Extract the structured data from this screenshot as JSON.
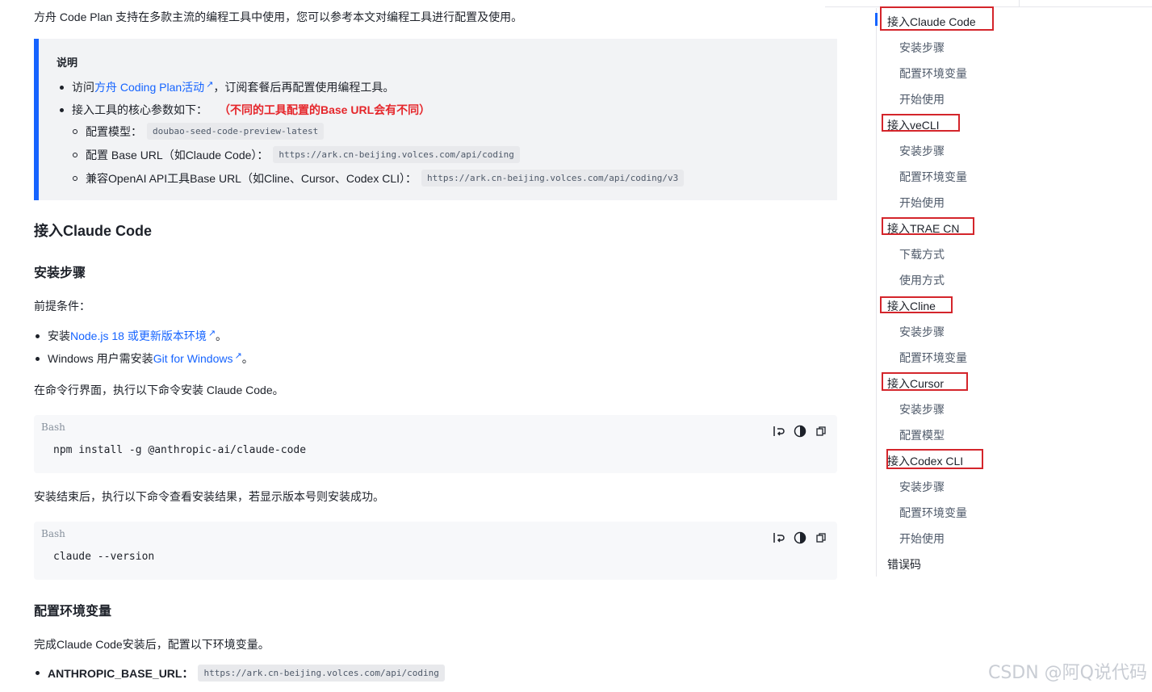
{
  "intro": "方舟 Code Plan 支持在多款主流的编程工具中使用，您可以参考本文对编程工具进行配置及使用。",
  "note": {
    "title": "说明",
    "item1_prefix": "访问",
    "item1_link": "方舟 Coding Plan活动",
    "item1_suffix": "，订阅套餐后再配置使用编程工具。",
    "item2": "接入工具的核心参数如下：",
    "item2_red": "（不同的工具配置的Base URL会有不同）",
    "sub1_label": "配置模型：",
    "sub1_code": "doubao-seed-code-preview-latest",
    "sub2_label": "配置 Base URL（如Claude Code）：",
    "sub2_code": "https://ark.cn-beijing.volces.com/api/coding",
    "sub3_label": "兼容OpenAI API工具Base URL（如Cline、Cursor、Codex CLI）：",
    "sub3_code": "https://ark.cn-beijing.volces.com/api/coding/v3"
  },
  "section": {
    "h2": "接入Claude Code",
    "install_h3": "安装步骤",
    "prereq": "前提条件：",
    "pre1_prefix": "安装 ",
    "pre1_link": "Node.js 18 或更新版本环境",
    "pre1_suffix": "。",
    "pre2_prefix": "Windows 用户需安装 ",
    "pre2_link": "Git for Windows",
    "pre2_suffix": "。",
    "cmd_intro": "在命令行界面，执行以下命令安装 Claude Code。",
    "code1_lang": "Bash",
    "code1": "npm install -g @anthropic-ai/claude-code",
    "after_install": "安装结束后，执行以下命令查看安装结果，若显示版本号则安装成功。",
    "code2_lang": "Bash",
    "code2": "claude --version",
    "env_h3": "配置环境变量",
    "env_intro": "完成Claude Code安装后，配置以下环境变量。",
    "env1_label": "ANTHROPIC_BASE_URL：",
    "env1_code": "https://ark.cn-beijing.volces.com/api/coding"
  },
  "toc": [
    {
      "label": "接入Claude Code",
      "level": 1
    },
    {
      "label": "安装步骤",
      "level": 2
    },
    {
      "label": "配置环境变量",
      "level": 2
    },
    {
      "label": "开始使用",
      "level": 2
    },
    {
      "label": "接入veCLI",
      "level": 1
    },
    {
      "label": "安装步骤",
      "level": 2
    },
    {
      "label": "配置环境变量",
      "level": 2
    },
    {
      "label": "开始使用",
      "level": 2
    },
    {
      "label": "接入TRAE CN",
      "level": 1
    },
    {
      "label": "下载方式",
      "level": 2
    },
    {
      "label": "使用方式",
      "level": 2
    },
    {
      "label": "接入Cline",
      "level": 1
    },
    {
      "label": "安装步骤",
      "level": 2
    },
    {
      "label": "配置环境变量",
      "level": 2
    },
    {
      "label": "接入Cursor",
      "level": 1
    },
    {
      "label": "安装步骤",
      "level": 2
    },
    {
      "label": "配置模型",
      "level": 2
    },
    {
      "label": "接入Codex CLI",
      "level": 1
    },
    {
      "label": "安装步骤",
      "level": 2
    },
    {
      "label": "配置环境变量",
      "level": 2
    },
    {
      "label": "开始使用",
      "level": 2
    },
    {
      "label": "错误码",
      "level": 1
    }
  ],
  "watermark": "CSDN @阿Q说代码",
  "colors": {
    "accent": "#1664ff",
    "highlight_box": "#d4252b",
    "warning_text": "#e5262b"
  }
}
